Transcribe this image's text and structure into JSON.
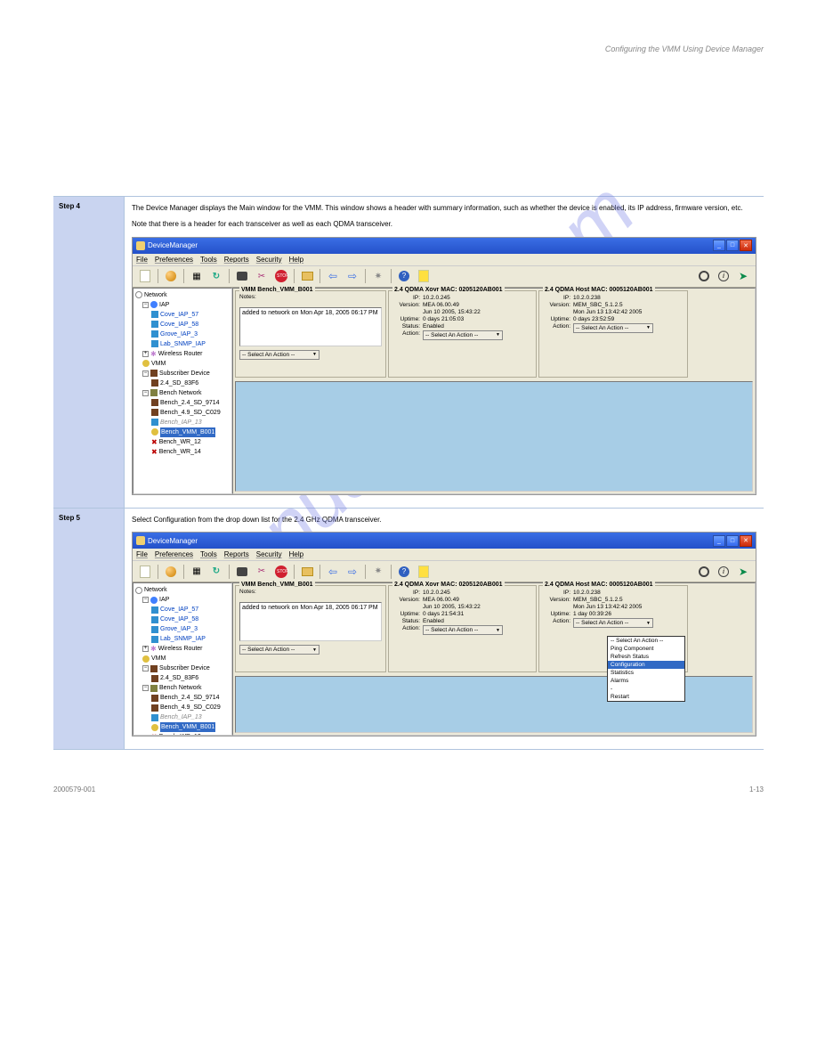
{
  "page_header": "Configuring the VMM Using Device Manager",
  "watermark": "manualshive.com",
  "footer_left": "2000579-001",
  "footer_right": "1-13",
  "step4": {
    "label": "Step 4",
    "desc1": "The Device Manager displays the Main window for the VMM. This window shows a header with summary information, such as whether the device is enabled, its IP address, firmware version, etc.",
    "desc2": "Note that there is a header for each transceiver as well as each QDMA transceiver."
  },
  "step5": {
    "label": "Step 5",
    "desc": "Select Configuration from the drop down list for the 2.4 GHz QDMA transceiver."
  },
  "window": {
    "title": "DeviceManager",
    "menu": [
      "File",
      "Preferences",
      "Tools",
      "Reports",
      "Security",
      "Help"
    ]
  },
  "tree": {
    "root": "Network",
    "iap_group": "IAP",
    "iaps": [
      "Cove_IAP_57",
      "Cove_IAP_58",
      "Grove_IAP_3",
      "Lab_SNMP_IAP"
    ],
    "wr": "Wireless Router",
    "vmm": "VMM",
    "sd_group": "Subscriber Device",
    "sd": "2.4_SD_83F6",
    "bn_group": "Bench Network",
    "bn": [
      "Bench_2.4_SD_9714",
      "Bench_4.9_SD_C029",
      "Bench_IAP_13",
      "Bench_VMM_B001",
      "Bench_WR_12",
      "Bench_WR_14"
    ]
  },
  "panel1": {
    "title": "VMM Bench_VMM_B001",
    "notes_label": "Notes:",
    "notes": "added to network on Mon Apr 18, 2005 06:17 PM",
    "action": "-- Select An Action --"
  },
  "panel2": {
    "title": "2.4 QDMA Xovr MAC: 0205120AB001",
    "ip_label": "IP:",
    "ip": "10.2.0.245",
    "ver_label": "Version:",
    "ver1": "MEA 06.00.49",
    "ver2": "Jun 10 2005, 15:43:22",
    "up_label": "Uptime:",
    "up": "0 days 21:05:03",
    "up_b": "0 days 21:54:31",
    "st_label": "Status:",
    "st": "Enabled",
    "ac_label": "Action:",
    "ac": "-- Select An Action --"
  },
  "panel3": {
    "title": "2.4 QDMA Host MAC: 0005120AB001",
    "ip_label": "IP:",
    "ip": "10.2.0.238",
    "ver_label": "Version:",
    "ver1": "MEM_SBC_5.1.2.5",
    "ver2": "Mon Jun 13 13:42:42 2005",
    "up_label": "Uptime:",
    "up": "0 days 23:52:59",
    "up_b": "1 day 00:39:26",
    "ac_label": "Action:",
    "ac": "-- Select An Action --"
  },
  "dropdown": {
    "items": [
      "-- Select An Action --",
      "Ping Component",
      "Refresh Status",
      "Configuration",
      "Statistics",
      "Alarms",
      "-",
      "Restart"
    ],
    "highlight": "Configuration"
  }
}
